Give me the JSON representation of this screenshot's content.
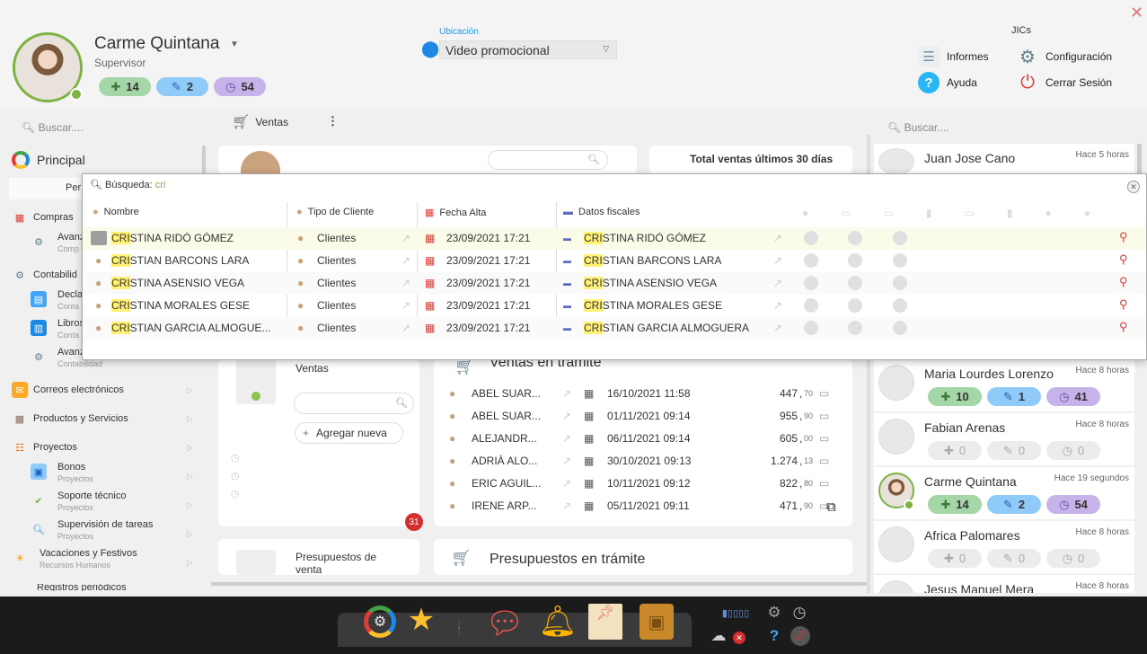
{
  "user": {
    "name": "Carme Quintana",
    "role": "Supervisor",
    "badges": {
      "added": "14",
      "edited": "2",
      "pending": "54"
    }
  },
  "location": {
    "label": "Ubicación",
    "value": "Video promocional"
  },
  "top_menu": {
    "group_label": "JICs",
    "reports": "Informes",
    "config": "Configuración",
    "help": "Ayuda",
    "logout": "Cerrar Sesión"
  },
  "search": {
    "left_placeholder": "Buscar....",
    "right_placeholder": "Buscar...."
  },
  "toolbar": {
    "sales_tab": "Ventas"
  },
  "sidebar": {
    "principal": "Principal",
    "personal_fragment": "Per",
    "items": [
      {
        "label": "Compras"
      },
      {
        "label": "Avanz",
        "sub": "Comp"
      },
      {
        "label": "Contabilid"
      },
      {
        "label": "Decla",
        "sub": "Conta"
      },
      {
        "label": "Libros",
        "sub": "Conta"
      },
      {
        "label": "Avanz",
        "sub": "Contabilidad"
      },
      {
        "label": "Correos electrónicos"
      },
      {
        "label": "Productos y Servicios"
      },
      {
        "label": "Proyectos"
      },
      {
        "label": "Bonos",
        "sub": "Proyectos"
      },
      {
        "label": "Soporte técnico",
        "sub": "Proyectos"
      },
      {
        "label": "Supervisión de tareas",
        "sub": "Proyectos"
      },
      {
        "label": "Vacaciones y Festivos",
        "sub": "Recursos Humanos"
      },
      {
        "label": "Registros periódicos"
      }
    ]
  },
  "dashboard": {
    "total_sales_title": "Total ventas últimos 30 días",
    "sales_card_title": "Ventas",
    "add_new": "Agregar nueva",
    "sales_count_badge": "31",
    "sales_in_process_title": "Ventas en trámite",
    "budgets_card_title": "Presupuestos de venta",
    "budgets_in_process_title": "Presupuestos en trámite",
    "sales_rows": [
      {
        "client": "ABEL SUAR...",
        "date": "16/10/2021 11:58",
        "amount": "447",
        "dec": "70"
      },
      {
        "client": "ABEL SUAR...",
        "date": "01/11/2021 09:14",
        "amount": "955",
        "dec": "90"
      },
      {
        "client": "ALEJANDR...",
        "date": "06/11/2021 09:14",
        "amount": "605",
        "dec": "00"
      },
      {
        "client": "ADRIÀ ALO...",
        "date": "30/10/2021 09:13",
        "amount": "1.274",
        "dec": "13"
      },
      {
        "client": "ERIC AGUIL...",
        "date": "10/11/2021 09:12",
        "amount": "822",
        "dec": "80"
      },
      {
        "client": "IRENE ARP...",
        "date": "05/11/2021 09:11",
        "amount": "471",
        "dec": "90"
      }
    ]
  },
  "search_popup": {
    "label": "Búsqueda:",
    "query": "cri",
    "columns": {
      "name": "Nombre",
      "client_type": "Tipo de Cliente",
      "date": "Fecha Alta",
      "fiscal": "Datos fiscales"
    },
    "rows": [
      {
        "hl": "CRI",
        "rest": "STINA RIDÓ GÓMEZ",
        "type": "Clientes",
        "date": "23/09/2021 17:21",
        "fhl": "CRI",
        "frest": "STINA RIDÓ GÓMEZ"
      },
      {
        "hl": "CRI",
        "rest": "STIAN BARCONS LARA",
        "type": "Clientes",
        "date": "23/09/2021 17:21",
        "fhl": "CRI",
        "frest": "STIAN BARCONS LARA"
      },
      {
        "hl": "CRI",
        "rest": "STINA ASENSIO VEGA",
        "type": "Clientes",
        "date": "23/09/2021 17:21",
        "fhl": "CRI",
        "frest": "STINA ASENSIO VEGA"
      },
      {
        "hl": "CRI",
        "rest": "STINA MORALES GESE",
        "type": "Clientes",
        "date": "23/09/2021 17:21",
        "fhl": "CRI",
        "frest": "STINA MORALES GESE"
      },
      {
        "hl": "CRI",
        "rest": "STIAN GARCIA ALMOGUE...",
        "type": "Clientes",
        "date": "23/09/2021 17:21",
        "fhl": "CRI",
        "frest": "STIAN GARCIA ALMOGUERA"
      }
    ]
  },
  "users_panel": [
    {
      "name": "Juan Jose Cano",
      "time": "Hace 5 horas"
    },
    {
      "name": "Maria Lourdes Lorenzo",
      "time": "Hace 8 horas",
      "a": "10",
      "b": "1",
      "c": "41"
    },
    {
      "name": "Fabian Arenas",
      "time": "Hace 8 horas",
      "a": "0",
      "b": "0",
      "c": "0"
    },
    {
      "name": "Carme Quintana",
      "time": "Hace 19 segundos",
      "a": "14",
      "b": "2",
      "c": "54"
    },
    {
      "name": "Africa Palomares",
      "time": "Hace 8 horas",
      "a": "0",
      "b": "0",
      "c": "0"
    },
    {
      "name": "Jesus Manuel Mera",
      "time": "Hace 8 horas"
    }
  ],
  "colors": {
    "accent_green": "#7cb342",
    "accent_blue": "#2196f3",
    "highlight": "#fff176",
    "badge_red": "#d32f2f"
  }
}
